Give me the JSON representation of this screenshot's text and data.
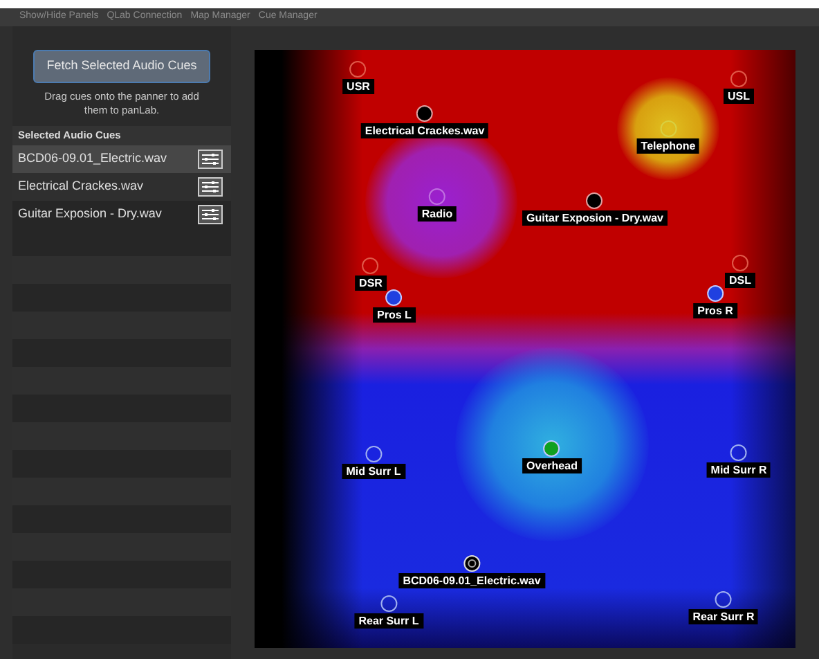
{
  "menu": [
    {
      "label": "Show/Hide Panels"
    },
    {
      "label": "QLab Connection"
    },
    {
      "label": "Map Manager"
    },
    {
      "label": "Cue Manager"
    }
  ],
  "sidebar": {
    "fetch_button": "Fetch Selected Audio Cues",
    "hint": "Drag cues onto the panner to add them to panLab.",
    "list_title": "Selected Audio Cues",
    "cues": [
      {
        "name": "BCD06-09.01_Electric.wav",
        "selected": true
      },
      {
        "name": "Electrical Crackes.wav",
        "selected": false
      },
      {
        "name": "Guitar Exposion - Dry.wav",
        "selected": false
      }
    ]
  },
  "panner": {
    "nodes": [
      {
        "label": "USR",
        "kind": "speaker",
        "color": "#e05a4a"
      },
      {
        "label": "Electrical Crackes.wav",
        "kind": "cue",
        "color": "#000000"
      },
      {
        "label": "USL",
        "kind": "speaker",
        "color": "#e05a4a"
      },
      {
        "label": "Telephone",
        "kind": "speaker",
        "color": "#d8d040"
      },
      {
        "label": "Radio",
        "kind": "speaker",
        "color": "#c070e0"
      },
      {
        "label": "Guitar Exposion - Dry.wav",
        "kind": "cue",
        "color": "#000000"
      },
      {
        "label": "DSR",
        "kind": "speaker",
        "color": "#e05a4a"
      },
      {
        "label": "DSL",
        "kind": "speaker",
        "color": "#e05a4a"
      },
      {
        "label": "Pros L",
        "kind": "active",
        "color": "#2040e0"
      },
      {
        "label": "Pros R",
        "kind": "active",
        "color": "#2040e0"
      },
      {
        "label": "Mid Surr L",
        "kind": "speaker",
        "color": "#a0b0f0"
      },
      {
        "label": "Overhead",
        "kind": "active",
        "color": "#10a020"
      },
      {
        "label": "Mid Surr R",
        "kind": "speaker",
        "color": "#a0b0f0"
      },
      {
        "label": "BCD06-09.01_Electric.wav",
        "kind": "selected_cue",
        "color": "#000000"
      },
      {
        "label": "Rear Surr L",
        "kind": "speaker",
        "color": "#a0b0f0"
      },
      {
        "label": "Rear Surr R",
        "kind": "speaker",
        "color": "#a0b0f0"
      }
    ]
  }
}
